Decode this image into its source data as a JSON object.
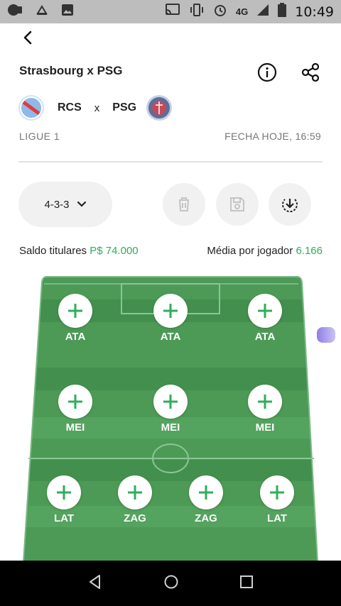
{
  "status_bar": {
    "network": "4G",
    "time": "10:49"
  },
  "header": {
    "title": "Strasbourg x PSG"
  },
  "match": {
    "home_abbr": "RCS",
    "separator": "x",
    "away_abbr": "PSG",
    "league": "LIGUE 1",
    "closing": "FECHA HOJE, 16:59"
  },
  "controls": {
    "formation": "4-3-3"
  },
  "stats": {
    "balance_label": "Saldo titulares",
    "balance_value": "P$ 74.000",
    "avg_label": "Média por jogador",
    "avg_value": "6.166"
  },
  "lineup": {
    "attack": [
      {
        "pos": "ATA"
      },
      {
        "pos": "ATA"
      },
      {
        "pos": "ATA"
      }
    ],
    "midfield": [
      {
        "pos": "MEI"
      },
      {
        "pos": "MEI"
      },
      {
        "pos": "MEI"
      }
    ],
    "defense": [
      {
        "pos": "LAT"
      },
      {
        "pos": "ZAG"
      },
      {
        "pos": "ZAG"
      },
      {
        "pos": "LAT"
      }
    ]
  },
  "colors": {
    "accent": "#2eae5a",
    "field_light": "#4c9a56",
    "field_dark": "#3f8a49",
    "status_bar": "#bdbdbd"
  }
}
